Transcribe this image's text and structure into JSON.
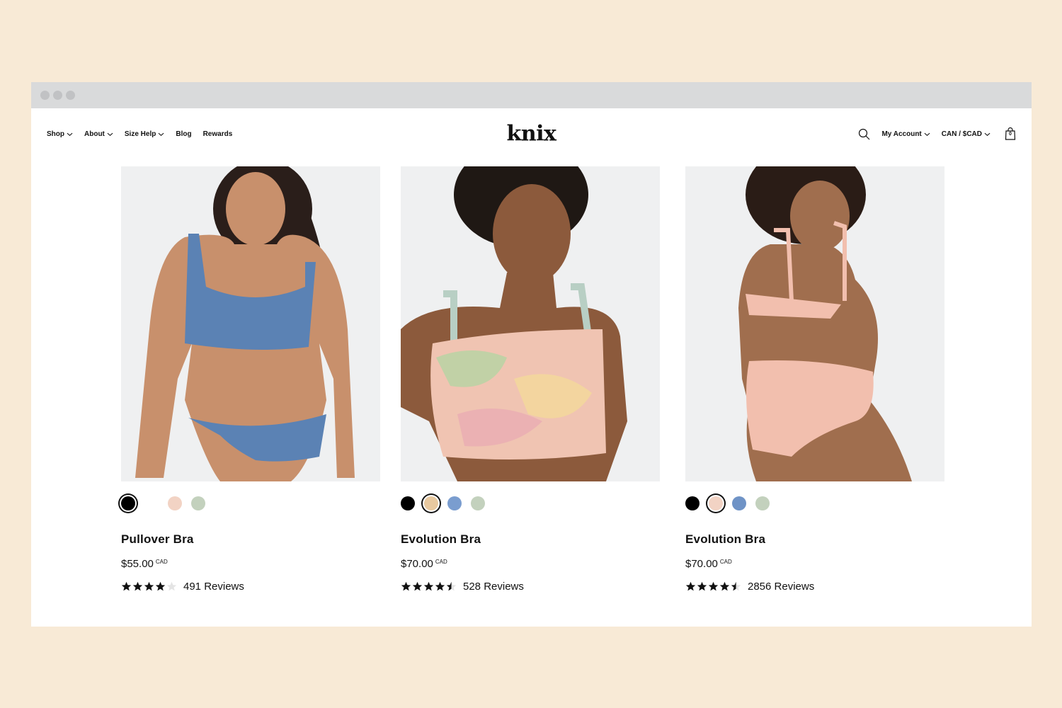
{
  "nav": {
    "left": [
      {
        "label": "Shop",
        "dropdown": true
      },
      {
        "label": "About",
        "dropdown": true
      },
      {
        "label": "Size Help",
        "dropdown": true
      },
      {
        "label": "Blog",
        "dropdown": false
      },
      {
        "label": "Rewards",
        "dropdown": false
      }
    ],
    "logo": "knix",
    "search_icon": "search-icon",
    "account_label": "My Account",
    "currency_label": "CAN / $CAD",
    "cart_icon": "shopping-bag-icon",
    "cart_count": "0"
  },
  "products": [
    {
      "name": "Pullover Bra",
      "price": "$55.00",
      "currency": "CAD",
      "reviews": "491 Reviews",
      "rating": 4,
      "garment_color": "#5b82b4",
      "skin_color": "#c8906c",
      "swatches": [
        "#000000",
        "#ffffff",
        "#f2d3c4",
        "#c3d1bd"
      ],
      "selected_swatch": 0
    },
    {
      "name": "Evolution Bra",
      "price": "$70.00",
      "currency": "CAD",
      "reviews": "528 Reviews",
      "rating": 4.5,
      "garment_color": "#f0c4b2",
      "skin_color": "#8c5a3c",
      "swatches": [
        "#000000",
        "#e8c9a0",
        "#7a9dcf",
        "#c3d1bd"
      ],
      "selected_swatch": 1
    },
    {
      "name": "Evolution Bra",
      "price": "$70.00",
      "currency": "CAD",
      "reviews": "2856 Reviews",
      "rating": 4.5,
      "garment_color": "#f2bfae",
      "skin_color": "#a06e4e",
      "swatches": [
        "#000000",
        "#f2d3c4",
        "#6f93c6",
        "#c3d1bd"
      ],
      "selected_swatch": 1
    }
  ]
}
